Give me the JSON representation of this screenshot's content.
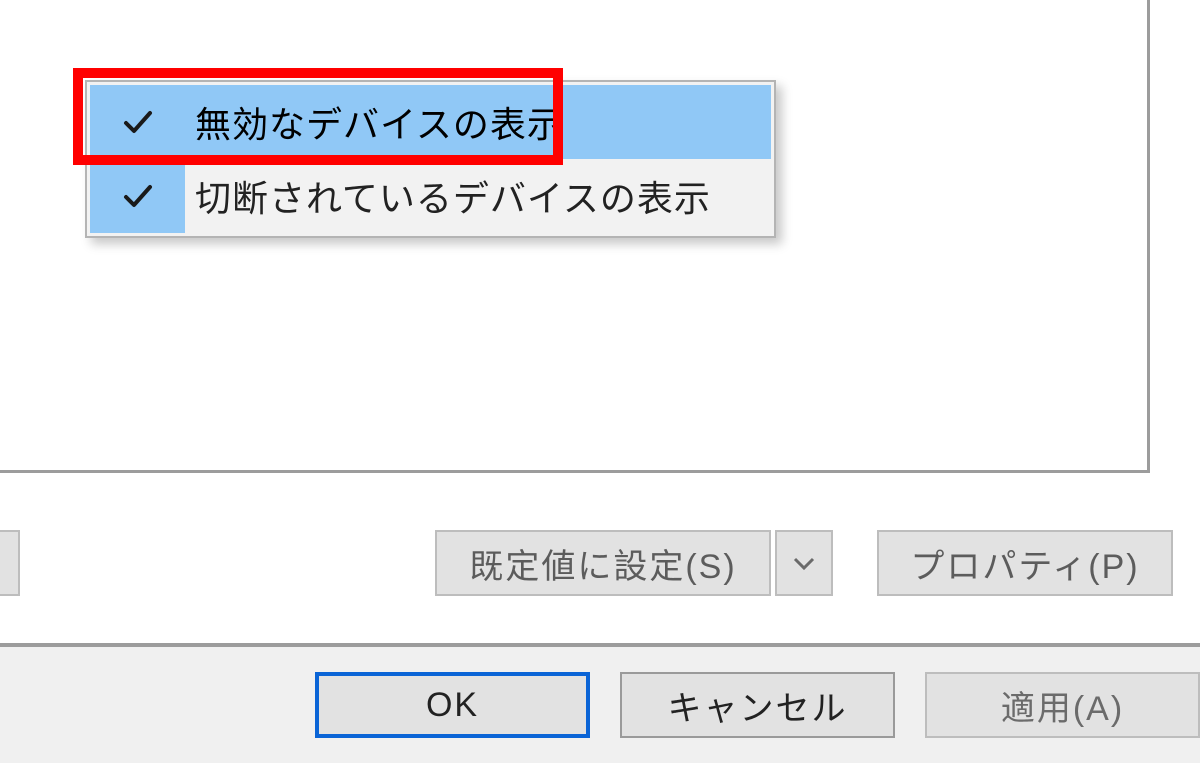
{
  "context_menu": {
    "items": [
      {
        "label": "無効なデバイスの表示",
        "checked": true,
        "selected": true
      },
      {
        "label": "切断されているデバイスの表示",
        "checked": true,
        "selected": false
      }
    ]
  },
  "middle_buttons": {
    "set_default": "既定値に設定(S)",
    "properties": "プロパティ(P)"
  },
  "dialog_buttons": {
    "ok": "OK",
    "cancel": "キャンセル",
    "apply": "適用(A)"
  }
}
